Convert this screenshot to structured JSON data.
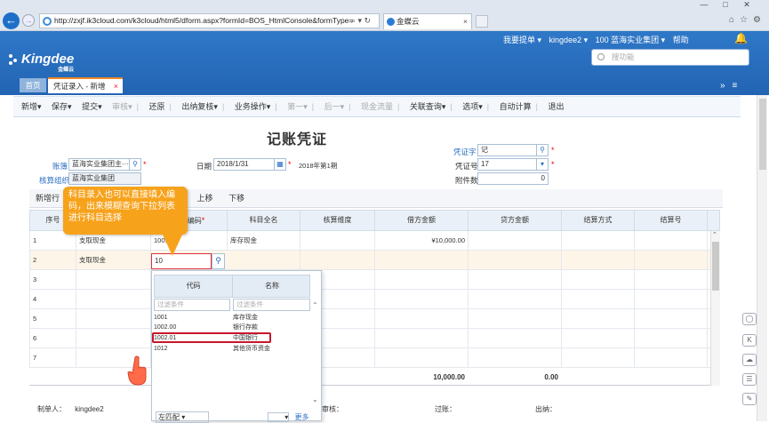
{
  "browser": {
    "url": "http://zxjf.ik3cloud.com/k3cloud/html5/dform.aspx?formId=BOS_HtmlConsole&formType=",
    "url_icons": "⌕ ▾ ↻",
    "tab_title": "金蝶云",
    "tab_close": "×",
    "win_min": "—",
    "win_max": "□",
    "win_close": "✕",
    "fav_icons": "⌂☆⚙"
  },
  "app": {
    "logo_text": "Kingdee",
    "logo_sub": "金蝶云",
    "nav": {
      "suggest": "我要提单 ▾",
      "user": "kingdee2 ▾",
      "org": "100 蓝海实业集团 ▾",
      "help": "帮助"
    },
    "feature_search_placeholder": "搜功能",
    "page_tabs": {
      "home": "首页",
      "voucher": "凭证录入 - 新增",
      "voucher_close": "×"
    },
    "tab_controls": "»≡"
  },
  "toolbar": {
    "new": "新增▾",
    "save": "保存▾",
    "submit": "提交▾",
    "audit": "审核▾",
    "restore": "还原",
    "cashier_review": "出纳复核▾",
    "business": "业务操作▾",
    "first": "第一▾",
    "next": "后一▾",
    "cashflow": "现金流量",
    "related_query": "关联查询▾",
    "options": "选项▾",
    "auto_calc": "自动计算",
    "exit": "退出"
  },
  "form": {
    "title": "记账凭证",
    "account_book_label": "账簿",
    "account_book_value": "蓝海实业集团主···",
    "accounting_org_label": "核算组织",
    "accounting_org_value": "蓝海实业集团",
    "date_label": "日期",
    "date_value": "2018/1/31",
    "period_text": "2018年第1期",
    "voucher_word_label": "凭证字",
    "voucher_word_value": "记",
    "voucher_no_label": "凭证号",
    "voucher_no_value": "17",
    "attachments_label": "附件数",
    "attachments_value": "0"
  },
  "entry_tabs": {
    "add_row": "新增行",
    "move_up": "上移",
    "move_down": "下移"
  },
  "grid": {
    "headers": {
      "seq": "序号",
      "summary": "摘要",
      "code": "科目编码",
      "full_name": "科目全名",
      "dimension": "核算维度",
      "debit": "借方金额",
      "credit": "贷方金额",
      "settle_method": "结算方式",
      "settle_no": "结算号"
    },
    "rows": [
      {
        "seq": "1",
        "summary": "支取现金",
        "code": "1001",
        "full_name": "库存现金",
        "debit": "¥10,000.00"
      },
      {
        "seq": "2",
        "summary": "支取现金",
        "code": "10",
        "full_name": "",
        "debit": ""
      },
      {
        "seq": "3"
      },
      {
        "seq": "4"
      },
      {
        "seq": "5"
      },
      {
        "seq": "6"
      },
      {
        "seq": "7"
      }
    ],
    "total_debit": "10,000.00",
    "total_credit": "0.00"
  },
  "dropdown": {
    "col_code": "代码",
    "col_name": "名称",
    "filter_placeholder": "过滤条件",
    "items": [
      {
        "code": "1001",
        "name": "库存现金"
      },
      {
        "code": "1002.00",
        "name": "银行存款"
      },
      {
        "code": "1002.01",
        "name": "中国银行"
      },
      {
        "code": "1012",
        "name": "其他货币资金"
      }
    ],
    "bottom_select": "左匹配",
    "more": "更多"
  },
  "callout": {
    "text": "科目录入也可以直接填入编码，出来模糊查询下拉列表进行科目选择"
  },
  "footer": {
    "maker_label": "制单人：",
    "maker_value": "kingdee2",
    "audit_label": "审核：",
    "post_label": "过账：",
    "cashier_label": "出纳："
  },
  "colors": {
    "brand": "#2264b3",
    "accent": "#f7a21b",
    "highlight": "#c6172c"
  }
}
